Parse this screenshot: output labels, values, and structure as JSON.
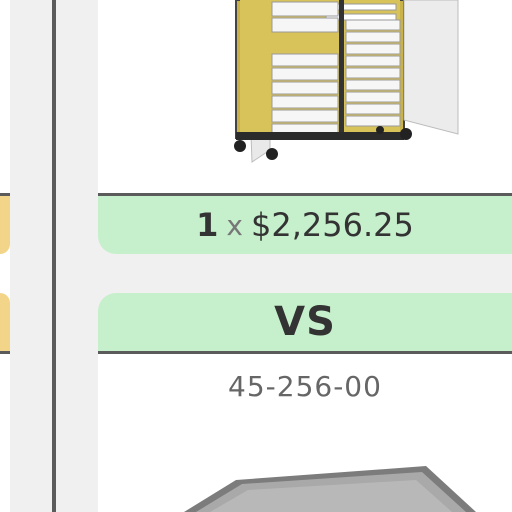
{
  "compare": {
    "quantity": "1",
    "times": "x",
    "price": "$2,256.25",
    "vs_label": "VS",
    "sku": "45-256-00"
  },
  "images": {
    "top": "storage-cart-image",
    "bottom": "tray-image"
  },
  "colors": {
    "band": "#c6efcc",
    "rule": "#5b5b5b",
    "tab": "#f3d58a",
    "background": "#f0f0f0"
  }
}
